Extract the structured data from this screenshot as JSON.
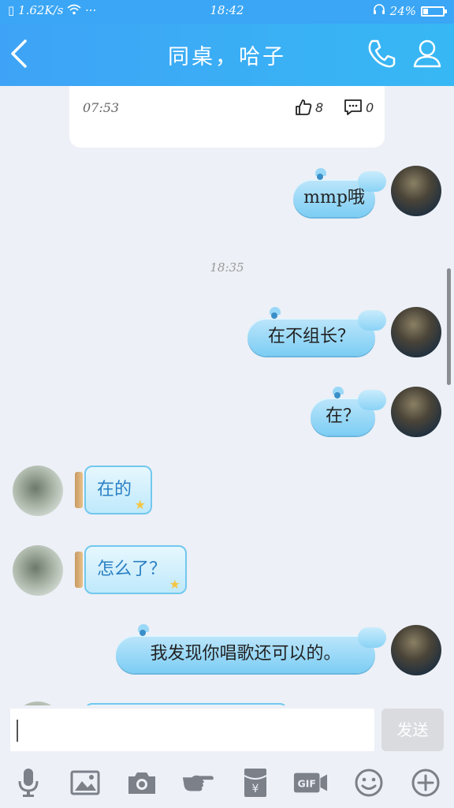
{
  "status_bar": {
    "network_speed": "1.62K/s",
    "more": "···",
    "time": "18:42",
    "battery": "24%",
    "battery_level": 0.24
  },
  "header": {
    "title": "同桌，哈子"
  },
  "chat": {
    "card": {
      "time": "07:53",
      "likes": "8",
      "comments": "0"
    },
    "timestamp": "18:35",
    "messages": [
      {
        "side": "out",
        "text": "mmp哦"
      },
      {
        "side": "out",
        "text": "在不组长？"
      },
      {
        "side": "out",
        "text": "在？"
      },
      {
        "side": "in",
        "text": "在的"
      },
      {
        "side": "in",
        "text": "怎么了？"
      },
      {
        "side": "out",
        "text": "我发现你唱歌还可以的。"
      }
    ]
  },
  "input": {
    "value": "",
    "send_label": "发送"
  },
  "toolbar": {
    "items": [
      "microphone-icon",
      "image-icon",
      "camera-icon",
      "poke-hand-icon",
      "red-packet-icon",
      "gif-icon",
      "emoji-icon",
      "plus-icon"
    ],
    "gif_label": "GIF"
  },
  "colors": {
    "header": "#3aa6f5",
    "bubble_out": "#7ccdf4",
    "bubble_in_text": "#2a7fc4",
    "background": "#edf0f6"
  }
}
